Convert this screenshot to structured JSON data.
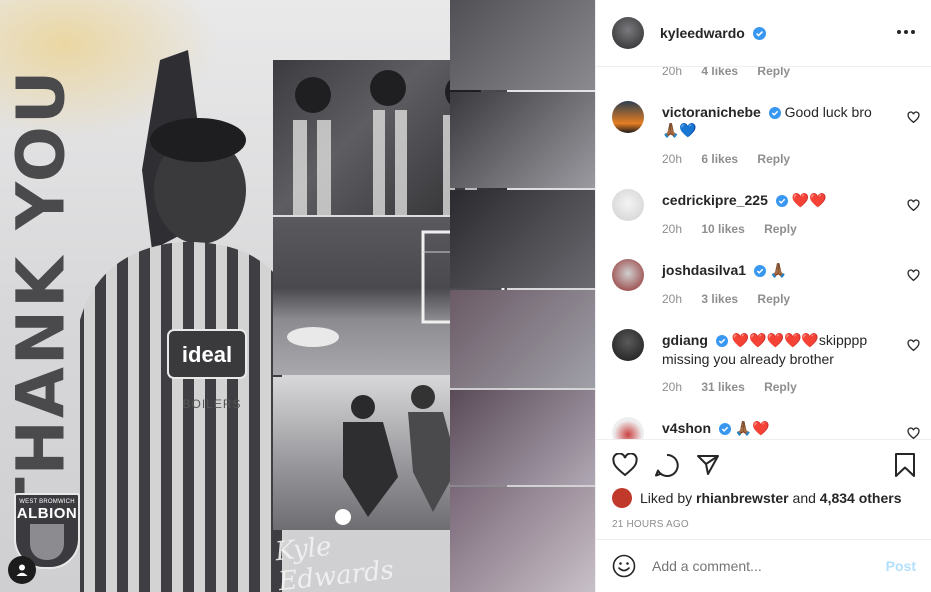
{
  "post_image": {
    "vertical_text": "THANK YOU",
    "crest_top": "WEST BROMWICH",
    "crest_main": "ALBION",
    "signature": "Kyle Edwards",
    "sponsor": "ideal",
    "sponsor_sub": "BOILERS"
  },
  "header": {
    "username": "kyleedwardo",
    "more_icon": "more-horizontal-icon"
  },
  "comments": [
    {
      "username": "",
      "text": "",
      "time": "20h",
      "likes": "4 likes",
      "reply": "Reply",
      "partial": true
    },
    {
      "username": "victoranichebe",
      "verified": true,
      "text": "Good luck bro",
      "emoji": "🙏🏾💙",
      "time": "20h",
      "likes": "6 likes",
      "reply": "Reply"
    },
    {
      "username": "cedrickipre_225",
      "verified": true,
      "text": "",
      "emoji": "❤️❤️",
      "time": "20h",
      "likes": "10 likes",
      "reply": "Reply"
    },
    {
      "username": "joshdasilva1",
      "verified": true,
      "text": "",
      "emoji": "🙏🏾",
      "time": "20h",
      "likes": "3 likes",
      "reply": "Reply"
    },
    {
      "username": "gdiang",
      "verified": true,
      "emoji": "❤️❤️❤️❤️❤️",
      "text": "skipppp missing you already brother",
      "time": "20h",
      "likes": "31 likes",
      "reply": "Reply"
    },
    {
      "username": "v4shon",
      "verified": true,
      "text": "",
      "emoji": "🙏🏾❤️"
    }
  ],
  "actions": {
    "liked_by_prefix": "Liked by",
    "liked_by_user": "rhianbrewster",
    "liked_by_and": "and",
    "liked_by_others": "4,834 others",
    "timestamp": "21 HOURS AGO"
  },
  "add_comment": {
    "placeholder": "Add a comment...",
    "post_label": "Post"
  },
  "colors": {
    "verified": "#3897f0",
    "muted": "#8e8e8e",
    "post_disabled": "#b2dffc"
  }
}
